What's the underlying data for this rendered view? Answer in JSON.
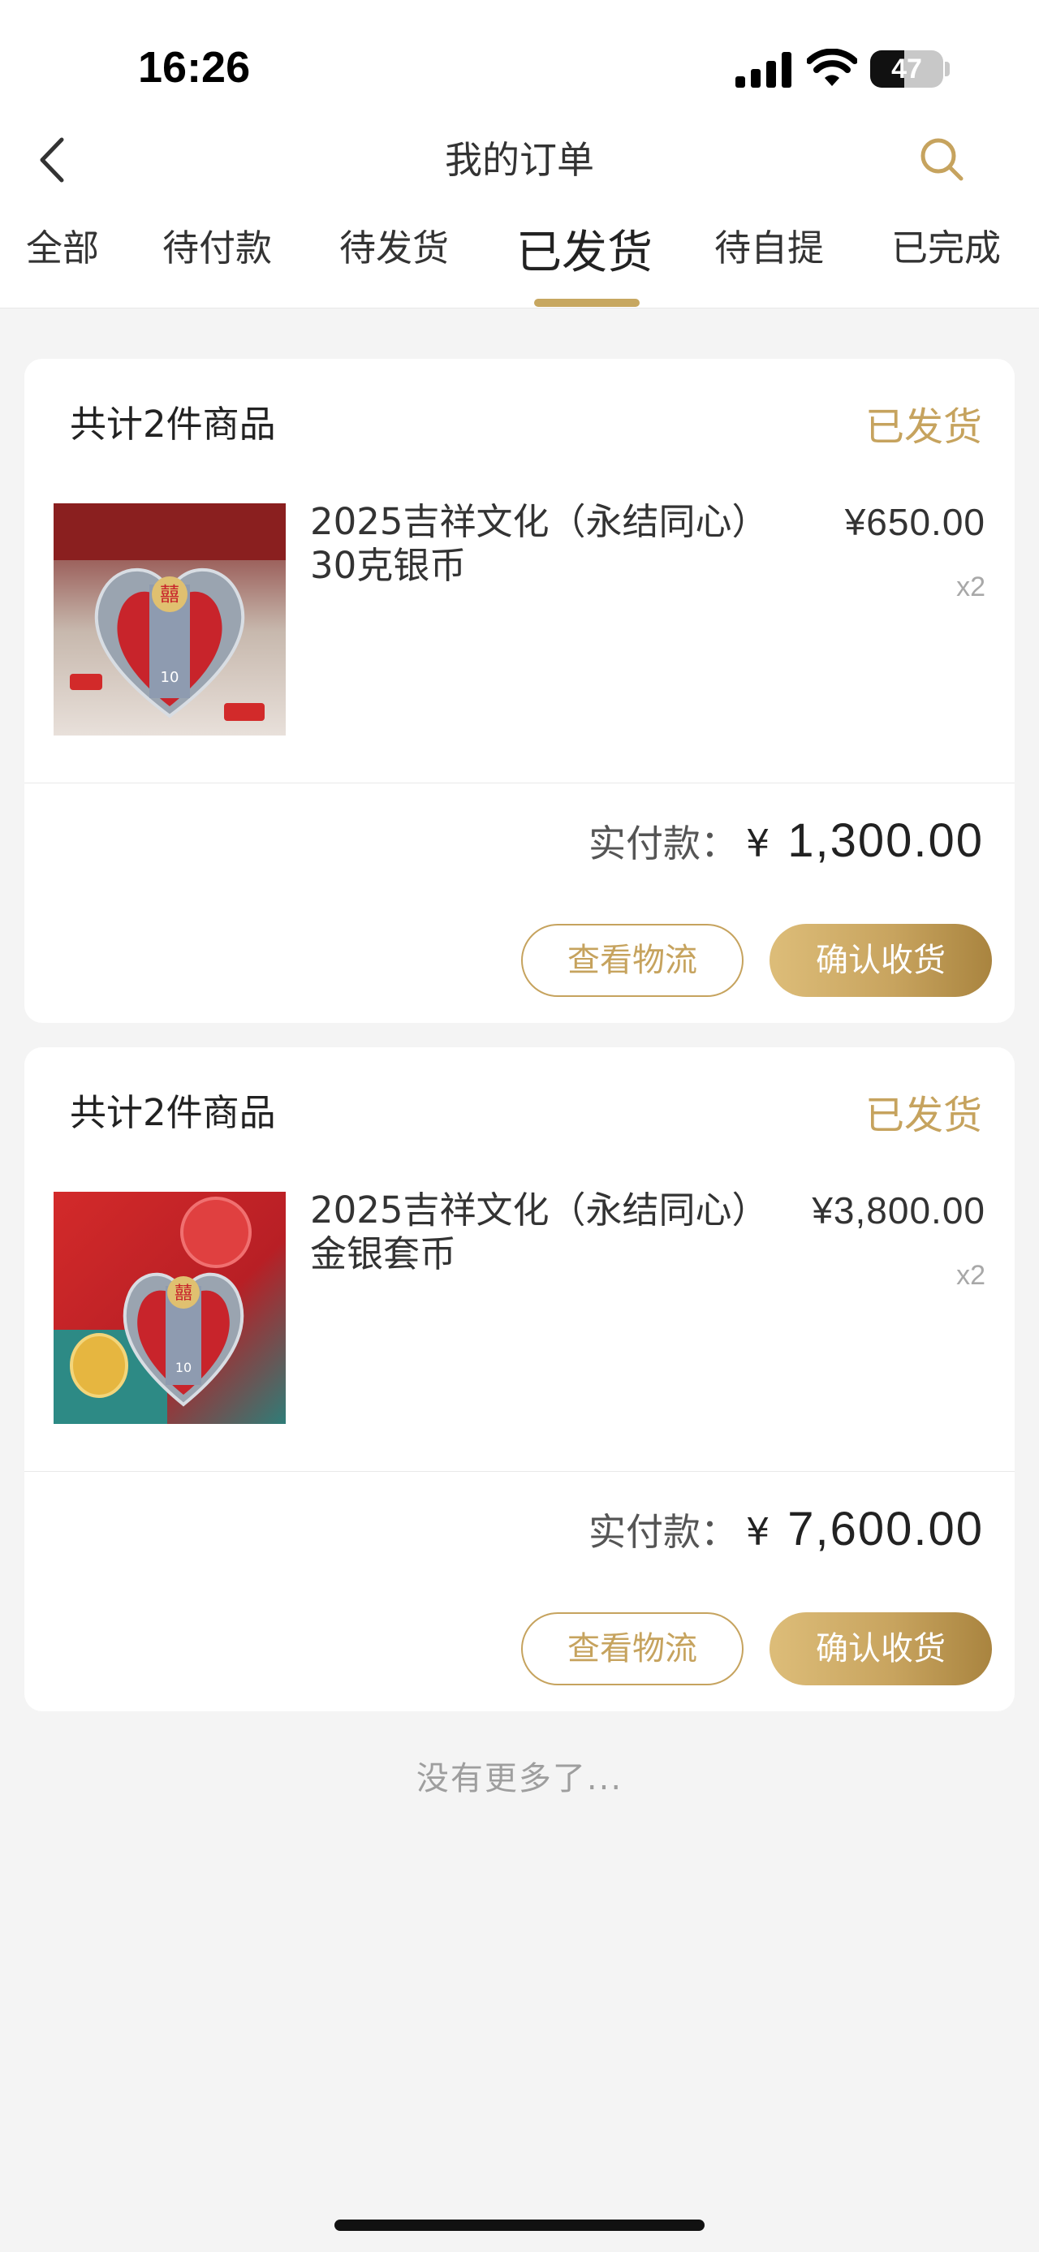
{
  "status_bar": {
    "time": "16:26",
    "battery": "47",
    "battery_level": 0.47,
    "icons": [
      "signal-icon",
      "wifi-icon",
      "battery-icon"
    ]
  },
  "header": {
    "title": "我的订单",
    "back_icon": "chevron-left-icon",
    "search_icon": "search-icon",
    "accent_color": "#c6a35e"
  },
  "tabs": [
    {
      "label": "全部",
      "active": false
    },
    {
      "label": "待付款",
      "active": false
    },
    {
      "label": "待发货",
      "active": false
    },
    {
      "label": "已发货",
      "active": true
    },
    {
      "label": "待自提",
      "active": false
    },
    {
      "label": "已完成",
      "active": false
    }
  ],
  "orders": [
    {
      "count_text": "共计2件商品",
      "status": "已发货",
      "product": {
        "name": "2025吉祥文化（永结同心）30克银币",
        "price": "¥650.00",
        "qty": "x2"
      },
      "paid_label": "实付款：",
      "paid_currency": "¥",
      "paid_amount": "1,300.00",
      "btn_logistics": "查看物流",
      "btn_confirm": "确认收货"
    },
    {
      "count_text": "共计2件商品",
      "status": "已发货",
      "product": {
        "name": "2025吉祥文化（永结同心）金银套币",
        "price": "¥3,800.00",
        "qty": "x2"
      },
      "paid_label": "实付款：",
      "paid_currency": "¥",
      "paid_amount": "7,600.00",
      "btn_logistics": "查看物流",
      "btn_confirm": "确认收货"
    }
  ],
  "footer": {
    "no_more": "没有更多了..."
  }
}
